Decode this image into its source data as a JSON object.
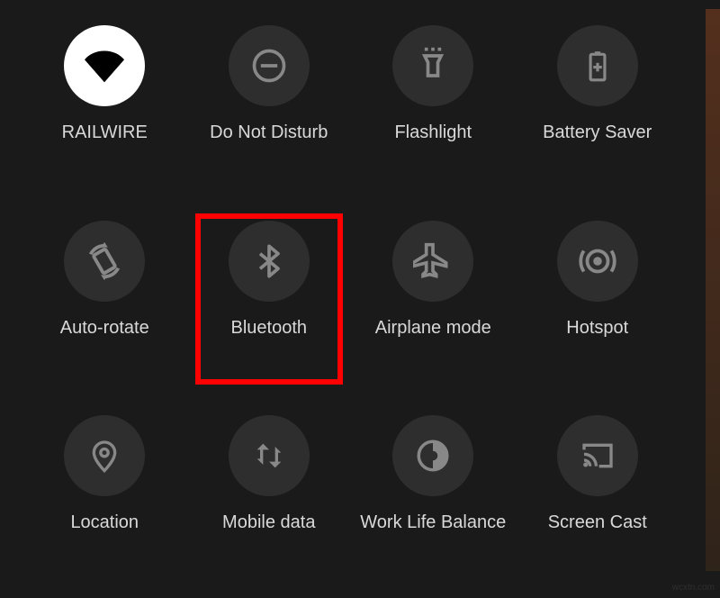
{
  "tiles": [
    {
      "label": "RAILWIRE",
      "icon": "wifi-icon",
      "active": true
    },
    {
      "label": "Do Not Disturb",
      "icon": "dnd-icon",
      "active": false
    },
    {
      "label": "Flashlight",
      "icon": "flashlight-icon",
      "active": false
    },
    {
      "label": "Battery Saver",
      "icon": "battery-icon",
      "active": false
    },
    {
      "label": "Auto-rotate",
      "icon": "rotate-icon",
      "active": false
    },
    {
      "label": "Bluetooth",
      "icon": "bluetooth-icon",
      "active": false,
      "highlighted": true
    },
    {
      "label": "Airplane mode",
      "icon": "airplane-icon",
      "active": false
    },
    {
      "label": "Hotspot",
      "icon": "hotspot-icon",
      "active": false
    },
    {
      "label": "Location",
      "icon": "location-icon",
      "active": false
    },
    {
      "label": "Mobile data",
      "icon": "mobiledata-icon",
      "active": false
    },
    {
      "label": "Work Life Balance",
      "icon": "worklife-icon",
      "active": false
    },
    {
      "label": "Screen Cast",
      "icon": "cast-icon",
      "active": false
    }
  ],
  "watermark": "wcxtn.com"
}
